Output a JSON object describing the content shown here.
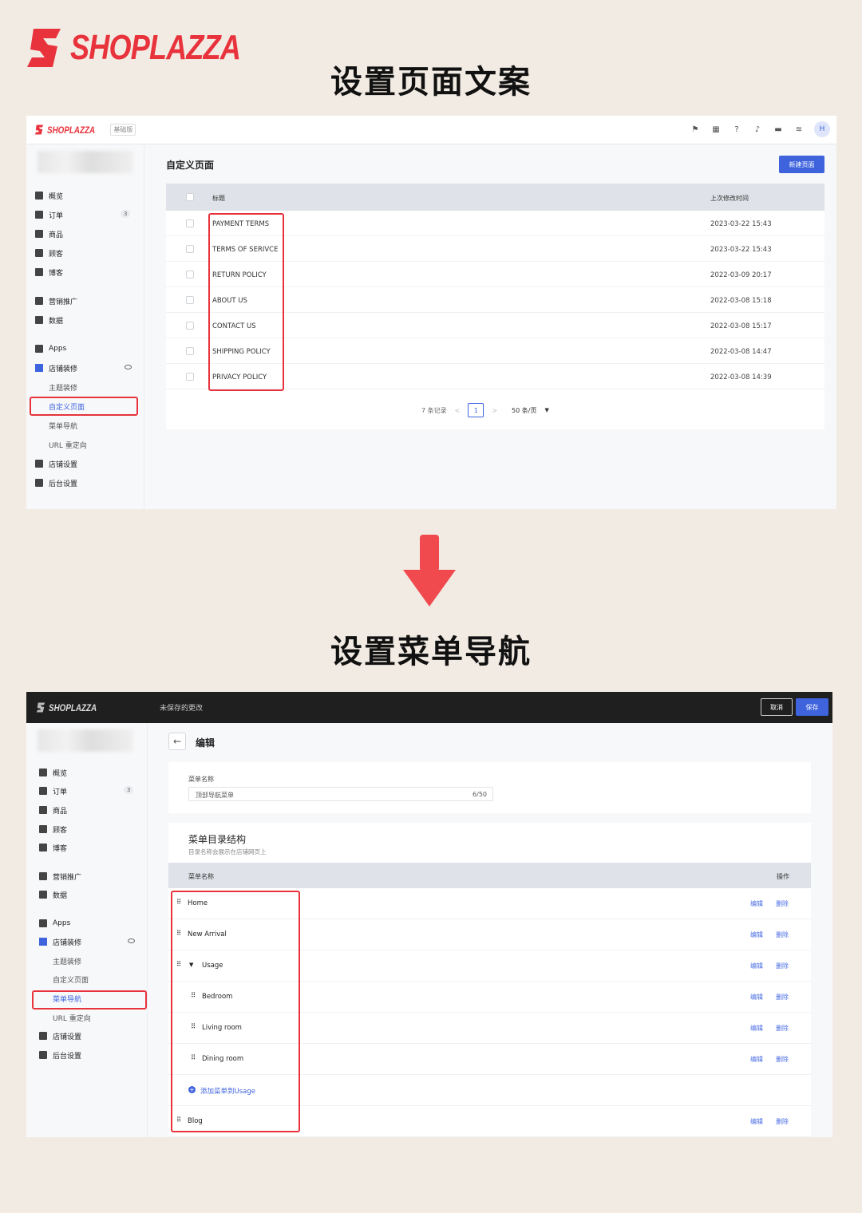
{
  "brand": {
    "name": "SHOPLAZZA",
    "color": "#e8333c"
  },
  "headlines": {
    "top": "设置页面文案",
    "bottom": "设置菜单导航"
  },
  "colors": {
    "accent": "#3e63dd",
    "highlight": "#e8333c",
    "background": "#f2ebe3"
  },
  "panel1": {
    "logo": "SHOPLAZZA",
    "plan_badge": "基础版",
    "top_icons": [
      "flag-icon",
      "store-icon",
      "help-icon",
      "bell-icon",
      "message-icon",
      "wifi-icon"
    ],
    "avatar": "H",
    "sidebar": {
      "items": [
        {
          "label": "概览",
          "icon": "overview-icon"
        },
        {
          "label": "订单",
          "icon": "order-icon",
          "count": "3"
        },
        {
          "label": "商品",
          "icon": "product-icon"
        },
        {
          "label": "顾客",
          "icon": "customer-icon"
        },
        {
          "label": "博客",
          "icon": "blog-icon"
        },
        {
          "label": "营销推广",
          "icon": "marketing-icon"
        },
        {
          "label": "数据",
          "icon": "data-icon"
        },
        {
          "label": "Apps",
          "icon": "apps-icon"
        },
        {
          "label": "店铺装修",
          "icon": "shop-icon"
        },
        {
          "label": "主题装修"
        },
        {
          "label": "自定义页面"
        },
        {
          "label": "菜单导航"
        },
        {
          "label": "URL 重定向"
        },
        {
          "label": "店铺设置",
          "icon": "settings-icon"
        },
        {
          "label": "后台设置",
          "icon": "admin-icon"
        }
      ]
    },
    "title": "自定义页面",
    "new_button": "新建页面",
    "table": {
      "headers": {
        "title": "标题",
        "modified": "上次修改时间"
      },
      "rows": [
        {
          "title": "PAYMENT TERMS",
          "modified": "2023-03-22 15:43"
        },
        {
          "title": "TERMS OF SERIVCE",
          "modified": "2023-03-22 15:43"
        },
        {
          "title": "RETURN POLICY",
          "modified": "2022-03-09 20:17"
        },
        {
          "title": "ABOUT US",
          "modified": "2022-03-08 15:18"
        },
        {
          "title": "CONTACT US",
          "modified": "2022-03-08 15:17"
        },
        {
          "title": "SHIPPING POLICY",
          "modified": "2022-03-08 14:47"
        },
        {
          "title": "PRIVACY POLICY",
          "modified": "2022-03-08 14:39"
        }
      ]
    },
    "pager": {
      "total": "7 条记录",
      "prev": "<",
      "page": "1",
      "next": ">",
      "page_size": "50 条/页"
    }
  },
  "panel2": {
    "logo": "SHOPLAZZA",
    "unsaved": "未保存的更改",
    "cancel": "取消",
    "save": "保存",
    "sidebar": {
      "items": [
        {
          "label": "概览"
        },
        {
          "label": "订单",
          "count": "3"
        },
        {
          "label": "商品"
        },
        {
          "label": "顾客"
        },
        {
          "label": "博客"
        },
        {
          "label": "营销推广"
        },
        {
          "label": "数据"
        },
        {
          "label": "Apps"
        },
        {
          "label": "店铺装修"
        },
        {
          "label": "主题装修"
        },
        {
          "label": "自定义页面"
        },
        {
          "label": "菜单导航"
        },
        {
          "label": "URL 重定向"
        },
        {
          "label": "店铺设置"
        },
        {
          "label": "后台设置"
        }
      ]
    },
    "back_icon": "arrow-left-icon",
    "edit_title": "编辑",
    "menu_name_label": "菜单名称",
    "menu_name_value": "顶部导航菜单",
    "menu_name_count": "6/50",
    "tree": {
      "title": "菜单目录结构",
      "subtitle": "目录名称会展示在店铺网页上",
      "header_name": "菜单名称",
      "header_ops": "操作",
      "edit_label": "编辑",
      "delete_label": "删除",
      "add_to_usage": "添加菜单到Usage",
      "items": [
        {
          "label": "Home"
        },
        {
          "label": "New Arrival"
        },
        {
          "label": "Usage"
        },
        {
          "label": "Bedroom"
        },
        {
          "label": "Living room"
        },
        {
          "label": "Dining room"
        },
        {
          "label": "Blog"
        }
      ]
    }
  }
}
